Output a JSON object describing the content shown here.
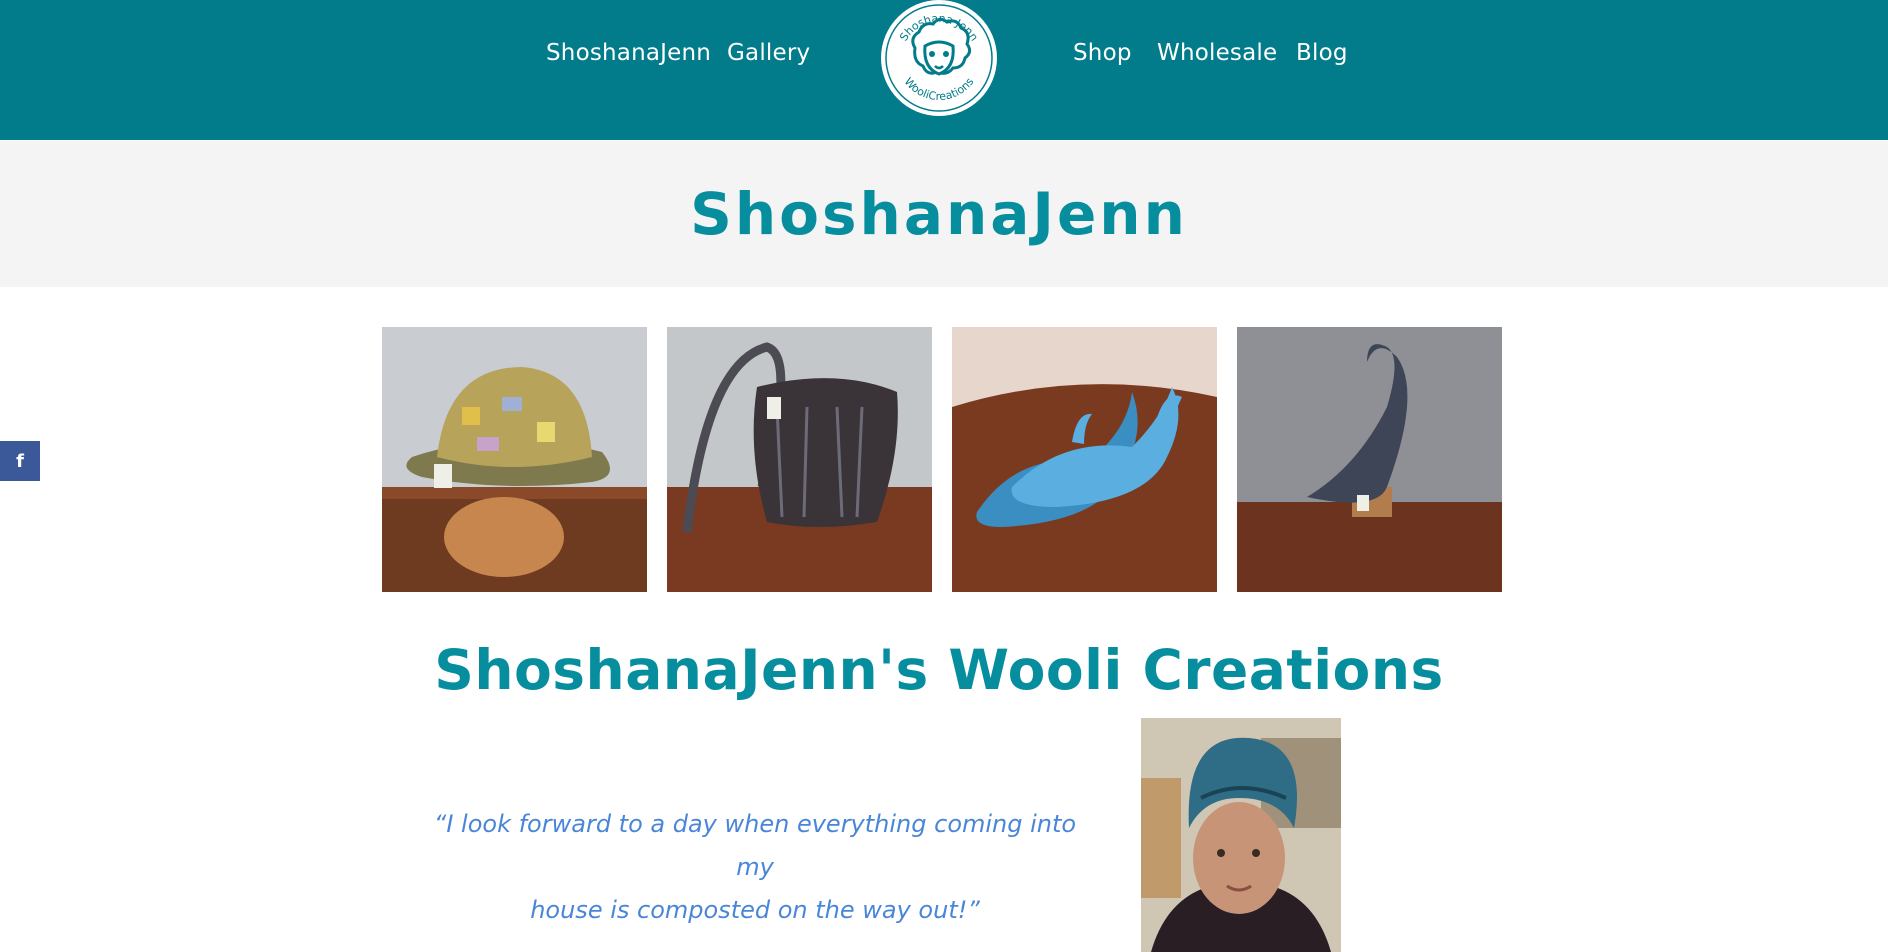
{
  "header": {
    "nav_left": [
      {
        "label": "ShoshanaJenn"
      },
      {
        "label": "Gallery"
      }
    ],
    "nav_right": [
      {
        "label": "Shop"
      },
      {
        "label": "Wholesale"
      },
      {
        "label": "Blog"
      }
    ],
    "logo": {
      "top_text": "Shoshana Jenn",
      "bottom_text": "WooliCreations"
    }
  },
  "page": {
    "title": "ShoshanaJenn"
  },
  "social": {
    "facebook_label": "f"
  },
  "gallery": {
    "items": [
      {
        "alt": "felted hat"
      },
      {
        "alt": "felted bag"
      },
      {
        "alt": "felted slippers"
      },
      {
        "alt": "felted pointed hat"
      }
    ]
  },
  "main": {
    "heading": "ShoshanaJenn's Wooli Creations",
    "quote_line1": "“I look forward to a day when everything coming into my",
    "quote_line2": "house is composted on the way out!”"
  },
  "colors": {
    "header_bg": "#027b8a",
    "accent": "#078e9e",
    "quote": "#4a86d8",
    "facebook": "#3b5998"
  }
}
